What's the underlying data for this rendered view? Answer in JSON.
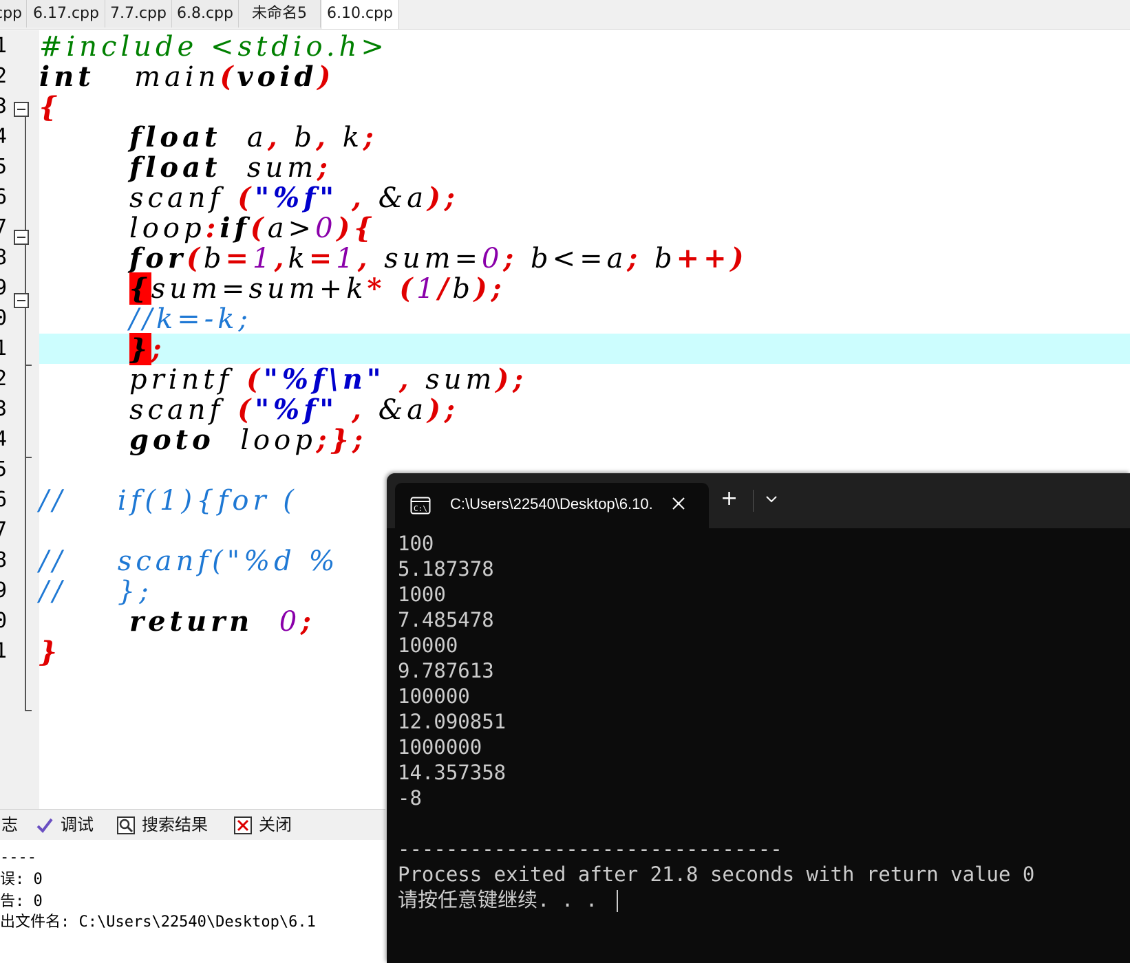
{
  "tabs": [
    {
      "label": "cpp",
      "active": false
    },
    {
      "label": "6.17.cpp",
      "active": false
    },
    {
      "label": "7.7.cpp",
      "active": false
    },
    {
      "label": "6.8.cpp",
      "active": false
    },
    {
      "label": "未命名5",
      "active": false
    },
    {
      "label": "6.10.cpp",
      "active": true
    }
  ],
  "editor": {
    "line_numbers": [
      "1",
      "2",
      "3",
      "4",
      "5",
      "6",
      "7",
      "8",
      "9",
      "0",
      "1",
      "2",
      "3",
      "4",
      "5",
      "6",
      "7",
      "8",
      "9",
      "0",
      "1"
    ],
    "current_line": 11,
    "lines": [
      [
        [
          "#include <stdio.h>",
          "pre"
        ]
      ],
      [
        [
          "int ",
          "kw"
        ],
        [
          "  main",
          "id"
        ],
        [
          "(",
          "pun"
        ],
        [
          "void",
          "kw"
        ],
        [
          ")",
          "pun"
        ]
      ],
      [
        [
          "{",
          "pun"
        ]
      ],
      [
        [
          "       ",
          "id"
        ],
        [
          "float",
          "kw"
        ],
        [
          "  a",
          "id"
        ],
        [
          ",",
          "pun"
        ],
        [
          " b",
          "id"
        ],
        [
          ",",
          "pun"
        ],
        [
          " k",
          "id"
        ],
        [
          ";",
          "pun"
        ]
      ],
      [
        [
          "       ",
          "id"
        ],
        [
          "float",
          "kw"
        ],
        [
          "  sum",
          "id"
        ],
        [
          ";",
          "pun"
        ]
      ],
      [
        [
          "       ",
          "id"
        ],
        [
          "scanf",
          "id"
        ],
        [
          " (",
          "pun"
        ],
        [
          "\"%f\"",
          "str"
        ],
        [
          " ,",
          "pun"
        ],
        [
          " &a",
          "id"
        ],
        [
          ");",
          "pun"
        ]
      ],
      [
        [
          "       ",
          "id"
        ],
        [
          "loop",
          "id"
        ],
        [
          ":",
          "pun"
        ],
        [
          "if",
          "kw"
        ],
        [
          "(",
          "pun"
        ],
        [
          "a>",
          "id"
        ],
        [
          "0",
          "num"
        ],
        [
          "){",
          "pun"
        ]
      ],
      [
        [
          "       ",
          "id"
        ],
        [
          "for",
          "kw"
        ],
        [
          "(",
          "pun"
        ],
        [
          "b",
          "id"
        ],
        [
          "=",
          "pun"
        ],
        [
          "1",
          "num"
        ],
        [
          ",",
          "pun"
        ],
        [
          "k",
          "id"
        ],
        [
          "=",
          "pun"
        ],
        [
          "1",
          "num"
        ],
        [
          ",",
          "pun"
        ],
        [
          " sum=",
          "id"
        ],
        [
          "0",
          "num"
        ],
        [
          ";",
          "pun"
        ],
        [
          " b<=a",
          "id"
        ],
        [
          ";",
          "pun"
        ],
        [
          " b",
          "id"
        ],
        [
          "++)",
          "pun"
        ]
      ],
      [
        [
          "       ",
          "id"
        ],
        [
          "{",
          "mark"
        ],
        [
          "sum=sum+k",
          "id"
        ],
        [
          "*",
          "pun"
        ],
        [
          " (",
          "pun"
        ],
        [
          "1",
          "num"
        ],
        [
          "/",
          "pun"
        ],
        [
          "b",
          "id"
        ],
        [
          ");",
          "pun"
        ]
      ],
      [
        [
          "       ",
          "id"
        ],
        [
          "//k=-k;",
          "cmt"
        ]
      ],
      [
        [
          "       ",
          "id"
        ],
        [
          "}",
          "mark"
        ],
        [
          ";",
          "pun"
        ]
      ],
      [
        [
          "       ",
          "id"
        ],
        [
          "printf",
          "id"
        ],
        [
          " (",
          "pun"
        ],
        [
          "\"%f\\n\"",
          "str"
        ],
        [
          " ,",
          "pun"
        ],
        [
          " sum",
          "id"
        ],
        [
          ");",
          "pun"
        ]
      ],
      [
        [
          "       ",
          "id"
        ],
        [
          "scanf",
          "id"
        ],
        [
          " (",
          "pun"
        ],
        [
          "\"%f\"",
          "str"
        ],
        [
          " ,",
          "pun"
        ],
        [
          " &a",
          "id"
        ],
        [
          ");",
          "pun"
        ]
      ],
      [
        [
          "       ",
          "id"
        ],
        [
          "goto",
          "kw"
        ],
        [
          "  loop",
          "id"
        ],
        [
          ";",
          "pun"
        ],
        [
          "}",
          "pun"
        ],
        [
          ";",
          "pun"
        ]
      ],
      [
        [
          "",
          "id"
        ]
      ],
      [
        [
          "//    if(1){for (",
          "cmt"
        ]
      ],
      [
        [
          "",
          "id"
        ]
      ],
      [
        [
          "//    scanf(\"%d %",
          "cmt"
        ]
      ],
      [
        [
          "//    };",
          "cmt"
        ]
      ],
      [
        [
          "       ",
          "id"
        ],
        [
          "return",
          "kw"
        ],
        [
          "  0",
          "num"
        ],
        [
          ";",
          "pun"
        ]
      ],
      [
        [
          "}",
          "pun"
        ]
      ]
    ]
  },
  "bottom_panel": {
    "tabs": [
      {
        "label": "志",
        "icon": "log-icon"
      },
      {
        "label": "调试",
        "icon": "check-icon"
      },
      {
        "label": "搜索结果",
        "icon": "search-icon"
      },
      {
        "label": "关闭",
        "icon": "close-icon"
      }
    ],
    "log_lines": [
      "----",
      "误: 0",
      "告: 0",
      "出文件名: C:\\Users\\22540\\Desktop\\6.1"
    ]
  },
  "terminal": {
    "tab_title": "C:\\Users\\22540\\Desktop\\6.10.",
    "tab_icon": "terminal-icon",
    "new_tab_label": "+",
    "output_lines": [
      "100",
      "5.187378",
      "1000",
      "7.485478",
      "10000",
      "9.787613",
      "100000",
      "12.090851",
      "1000000",
      "14.357358",
      "-8",
      "",
      "--------------------------------",
      "Process exited after 21.8 seconds with return value 0",
      "请按任意键继续. . . "
    ]
  },
  "colors": {
    "keyword": "#000000",
    "punct": "#e00000",
    "string": "#0000cc",
    "number": "#8a00aa",
    "comment": "#1e78d4",
    "preprocessor": "#008000",
    "current_line": "#ccfdfe",
    "terminal_bg": "#0c0c0c"
  }
}
